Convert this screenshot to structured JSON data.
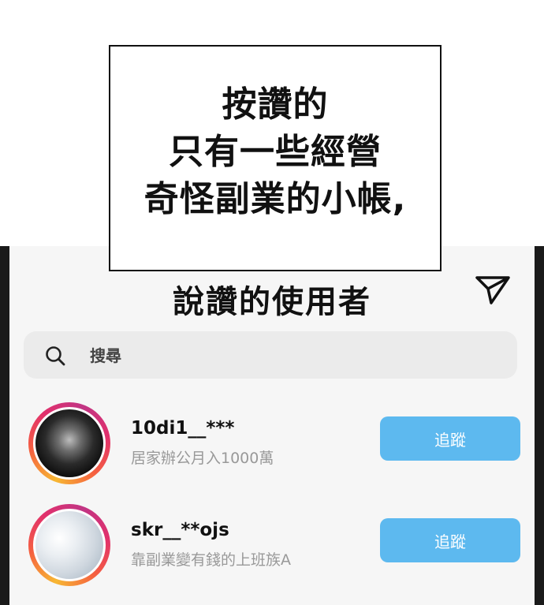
{
  "caption": {
    "lines": [
      "按讚的",
      "只有一些經營",
      "奇怪副業的小帳,"
    ]
  },
  "header": {
    "title": "說讚的使用者",
    "send_icon": "send-icon"
  },
  "search": {
    "placeholder": "搜尋",
    "icon": "search-icon"
  },
  "users": [
    {
      "username": "10di1__***",
      "bio": "居家辦公月入1000萬",
      "button_label": "追蹤",
      "avatar": "dark-blurred-photo"
    },
    {
      "username": "skr__**ojs",
      "bio": "靠副業變有錢的上班族A",
      "button_label": "追蹤",
      "avatar": "sky-cloud-photo"
    }
  ],
  "colors": {
    "follow_button": "#5db9ef",
    "ring_gradient": [
      "#f7b733",
      "#f56040",
      "#e1306c",
      "#c13584"
    ]
  }
}
